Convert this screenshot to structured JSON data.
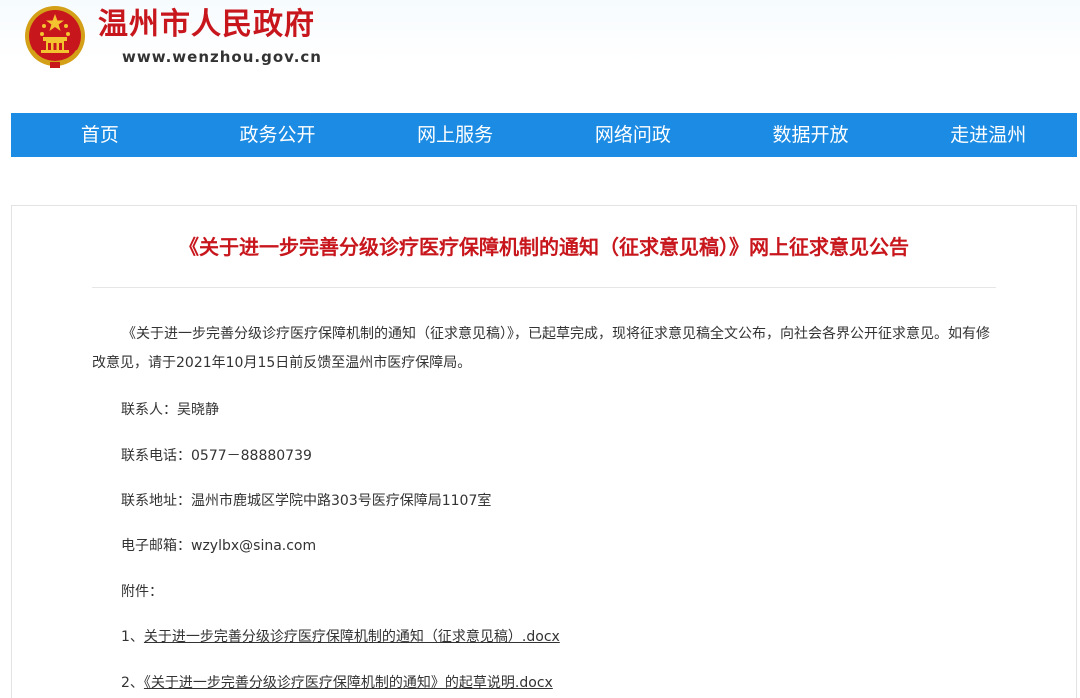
{
  "header": {
    "site_title": "温州市人民政府",
    "site_url": "www.wenzhou.gov.cn",
    "emblem_icon": "national-emblem-icon"
  },
  "nav": {
    "items": [
      {
        "label": "首页"
      },
      {
        "label": "政务公开"
      },
      {
        "label": "网上服务"
      },
      {
        "label": "网络问政"
      },
      {
        "label": "数据开放"
      },
      {
        "label": "走进温州"
      }
    ]
  },
  "article": {
    "title": "《关于进一步完善分级诊疗医疗保障机制的通知（征求意见稿）》网上征求意见公告",
    "intro": "《关于进一步完善分级诊疗医疗保障机制的通知（征求意见稿）》，已起草完成，现将征求意见稿全文公布，向社会各界公开征求意见。如有修改意见，请于2021年10月15日前反馈至温州市医疗保障局。",
    "contact_person": "联系人：吴晓静",
    "contact_phone": "联系电话：0577－88880739",
    "contact_address": "联系地址：温州市鹿城区学院中路303号医疗保障局1107室",
    "email_label": "电子邮箱：",
    "email": "wzylbx@sina.com",
    "attachments_label": "附件：",
    "attachments": [
      {
        "index": "1、",
        "name": "关于进一步完善分级诊疗医疗保障机制的通知（征求意见稿）.docx"
      },
      {
        "index": "2、",
        "name": "《关于进一步完善分级诊疗医疗保障机制的通知》的起草说明.docx"
      }
    ]
  },
  "colors": {
    "brand_red": "#c8161d",
    "nav_blue": "#1b8be3",
    "text": "#333333"
  }
}
